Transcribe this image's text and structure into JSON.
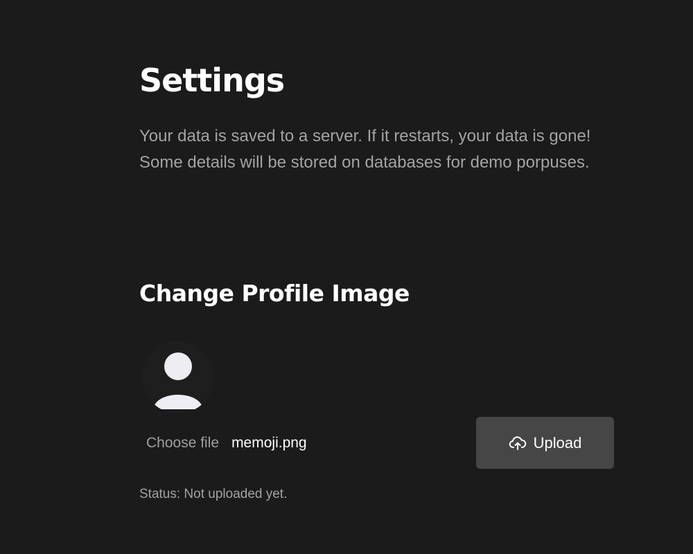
{
  "header": {
    "title": "Settings",
    "description": "Your data is saved to a server. If it restarts, your data is gone! Some details will be stored on databases for demo porpuses."
  },
  "profile_image": {
    "section_title": "Change Profile Image",
    "avatar_icon": "user-silhouette-icon",
    "file_input": {
      "button_label": "Choose file",
      "selected_file": "memoji.png"
    },
    "upload_button": {
      "label": "Upload",
      "icon": "cloud-upload-icon"
    },
    "status": "Status: Not uploaded yet."
  },
  "colors": {
    "background": "#1b1b1c",
    "heading": "#ffffff",
    "muted_text": "#a3a3a3",
    "button_background": "#464646",
    "avatar_fill": "#eeeef2"
  }
}
